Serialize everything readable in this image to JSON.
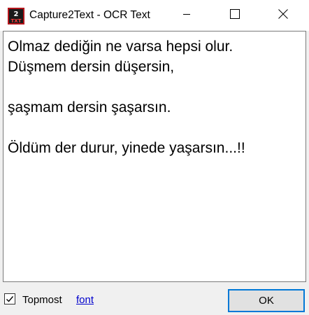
{
  "window": {
    "title": "Capture2Text - OCR Text",
    "icon": "capture2text-app-icon",
    "controls": [
      "minimize-icon",
      "maximize-icon",
      "close-icon"
    ]
  },
  "ocr_text": {
    "value": "Olmaz dediğin ne varsa hepsi olur.\nDüşmem dersin düşersin,\n\nşaşmam dersin şaşarsın.\n\nÖldüm der durur, yinede yaşarsın...!!"
  },
  "bottom": {
    "topmost_label": "Topmost",
    "topmost_checked": true,
    "font_link": "font",
    "ok_label": "OK"
  },
  "colors": {
    "accent": "#0078d7",
    "link": "#0000cc",
    "icon_red": "#b5151b"
  }
}
